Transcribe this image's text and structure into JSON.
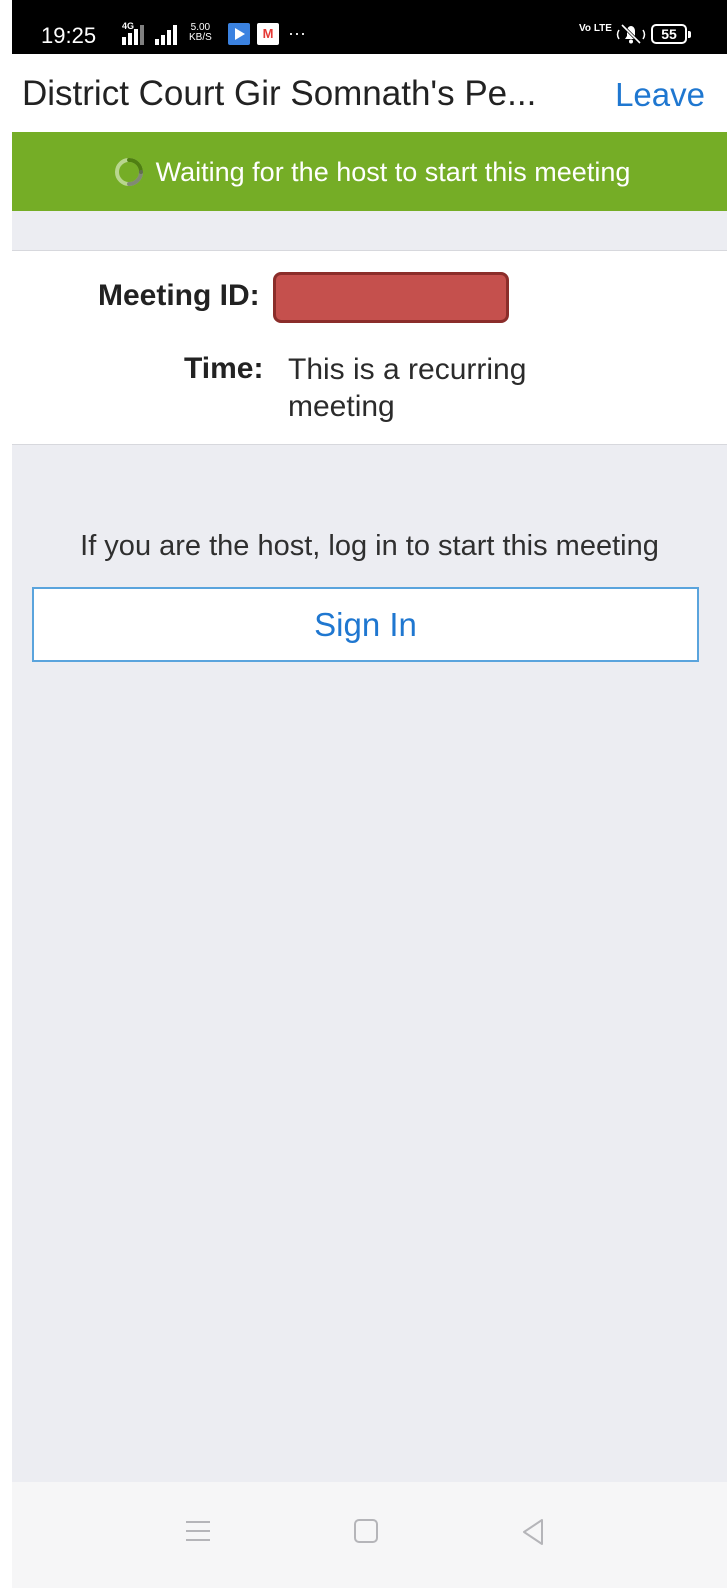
{
  "status_bar": {
    "time": "19:25",
    "network": "4G",
    "speed_value": "5.00",
    "speed_unit": "KB/S",
    "more": "···",
    "volte": "Vo LTE",
    "battery": "55",
    "icons": [
      "signal-icon",
      "youtube-icon",
      "m-app-icon",
      "volte-icon",
      "mute-icon",
      "battery-icon"
    ]
  },
  "header": {
    "title": "District Court Gir Somnath's Pe...",
    "leave_label": "Leave"
  },
  "banner": {
    "text": "Waiting for the host to start this meeting",
    "color": "#75ad26"
  },
  "meeting": {
    "id_label": "Meeting ID:",
    "id_value": "",
    "time_label": "Time:",
    "time_value": "This is a recurring meeting"
  },
  "host": {
    "prompt": "If you are the host, log in to start this meeting",
    "sign_in_label": "Sign In"
  },
  "navbar": {
    "icons": [
      "menu-icon",
      "home-icon",
      "back-icon"
    ]
  },
  "colors": {
    "accent": "#1f77d0",
    "banner_green": "#75ad26",
    "redaction": "#c5504d"
  }
}
